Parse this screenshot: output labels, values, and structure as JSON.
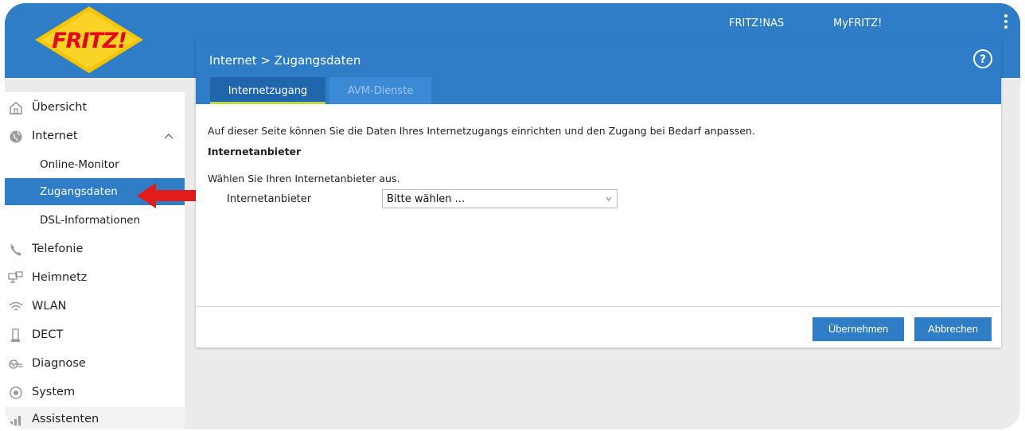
{
  "top": {
    "links": [
      "FRITZ!NAS",
      "MyFRITZ!"
    ],
    "logo_text": "FRITZ!"
  },
  "sidebar": {
    "items": [
      {
        "label": "Übersicht",
        "icon": "home-icon"
      },
      {
        "label": "Internet",
        "icon": "globe-icon"
      },
      {
        "label": "Online-Monitor"
      },
      {
        "label": "Zugangsdaten"
      },
      {
        "label": "DSL-Informationen"
      },
      {
        "label": "Telefonie",
        "icon": "phone-icon"
      },
      {
        "label": "Heimnetz",
        "icon": "network-icon"
      },
      {
        "label": "WLAN",
        "icon": "wifi-icon"
      },
      {
        "label": "DECT",
        "icon": "dect-icon"
      },
      {
        "label": "Diagnose",
        "icon": "diagnose-icon"
      },
      {
        "label": "System",
        "icon": "system-icon"
      },
      {
        "label": "Assistenten",
        "icon": "assistant-icon"
      }
    ]
  },
  "panel": {
    "breadcrumb": "Internet > Zugangsdaten",
    "tabs": [
      "Internetzugang",
      "AVM-Dienste"
    ],
    "intro": "Auf dieser Seite können Sie die Daten Ihres Internetzugangs einrichten und den Zugang bei Bedarf anpassen.",
    "section_title": "Internetanbieter",
    "choose_text": "Wählen Sie Ihren Internetanbieter aus.",
    "field_label": "Internetanbieter",
    "select_value": "Bitte wählen ...",
    "buttons": [
      "Übernehmen",
      "Abbrechen"
    ]
  },
  "colors": {
    "brand_blue": "#2f7dc6",
    "active_tab_underline": "#b7d94a",
    "annotation_arrow": "#e21b1b"
  }
}
